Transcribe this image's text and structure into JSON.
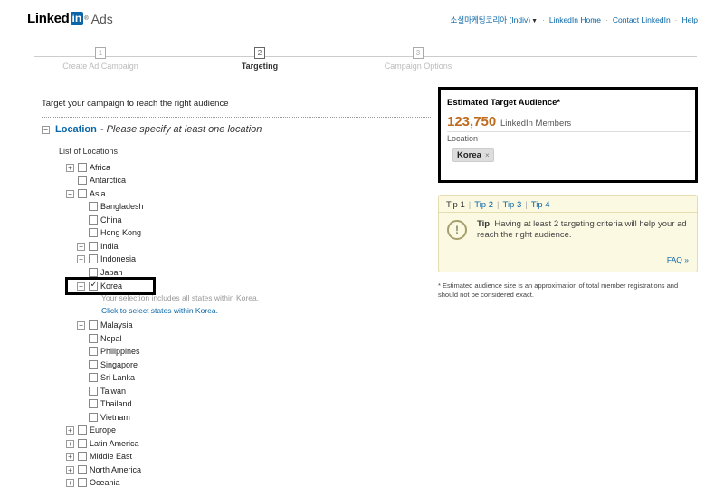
{
  "logo": {
    "linked": "Linked",
    "in": "in",
    "reg": "®",
    "ads": "Ads"
  },
  "topnav": {
    "account": "소셜마케팅코리아 (Indiv)",
    "home": "LinkedIn Home",
    "contact": "Contact LinkedIn",
    "help": "Help"
  },
  "steps": [
    {
      "num": "1",
      "label": "Create Ad Campaign"
    },
    {
      "num": "2",
      "label": "Targeting"
    },
    {
      "num": "3",
      "label": "Campaign Options"
    }
  ],
  "intro": "Target your campaign to reach the right audience",
  "location": {
    "toggle": "−",
    "title": "Location",
    "hint": "- Please specify at least one location"
  },
  "list_label": "List of Locations",
  "tree": {
    "africa": "Africa",
    "antarctica": "Antarctica",
    "asia": "Asia",
    "bangladesh": "Bangladesh",
    "china": "China",
    "hongkong": "Hong Kong",
    "india": "India",
    "indonesia": "Indonesia",
    "japan": "Japan",
    "korea": "Korea",
    "malaysia": "Malaysia",
    "nepal": "Nepal",
    "philippines": "Philippines",
    "singapore": "Singapore",
    "srilanka": "Sri Lanka",
    "taiwan": "Taiwan",
    "thailand": "Thailand",
    "vietnam": "Vietnam",
    "europe": "Europe",
    "latinamerica": "Latin America",
    "middleeast": "Middle East",
    "northamerica": "North America",
    "oceania": "Oceania"
  },
  "korea_note": "Your selection includes all states within Korea.",
  "korea_link": "Click to select states within Korea.",
  "estimate": {
    "title": "Estimated Target Audience*",
    "count": "123,750",
    "members": "LinkedIn Members",
    "location_label": "Location",
    "chip": "Korea",
    "chip_remove": "×"
  },
  "tips": {
    "tab1": "Tip 1",
    "tab2": "Tip 2",
    "tab3": "Tip 3",
    "tab4": "Tip 4",
    "icon": "!",
    "lead": "Tip",
    "text": ": Having at least 2 targeting criteria will help your ad reach the right audience.",
    "faq": "FAQ »"
  },
  "disclaimer": "* Estimated audience size is an approximation of total member registrations and should not be considered exact."
}
